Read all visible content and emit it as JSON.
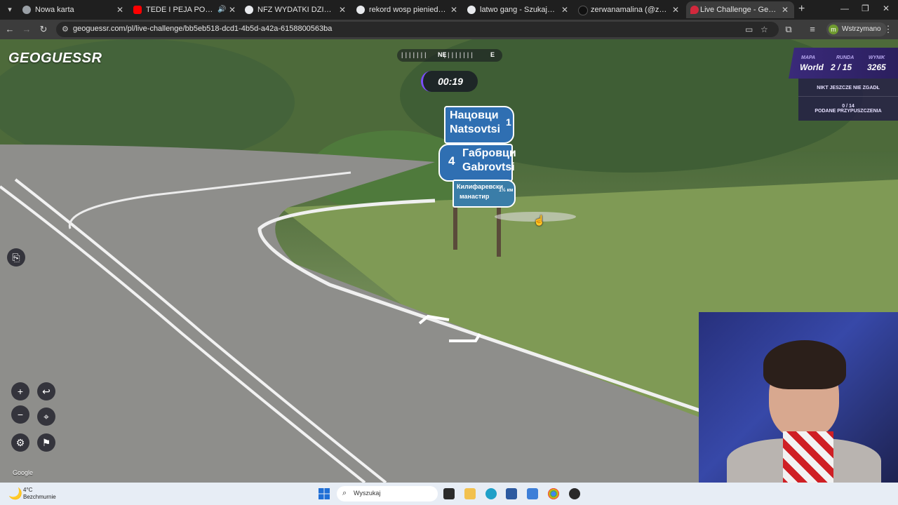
{
  "browser": {
    "tabs": [
      {
        "title": "Nowa karta",
        "active": false
      },
      {
        "title": "TEDE I PEJA POGODZENI? | ...",
        "active": false
      },
      {
        "title": "NFZ WYDATKI DZIENNIE - Szuk",
        "active": false
      },
      {
        "title": "rekord wosp pieniedzy - Szukaj",
        "active": false
      },
      {
        "title": "latwo gang - Szukaj w Google",
        "active": false
      },
      {
        "title": "zerwanamalina (@zerwanamal",
        "active": false
      },
      {
        "title": "Live Challenge - GeoGuessr",
        "active": true
      }
    ],
    "url": "geoguessr.com/pl/live-challenge/bb5eb518-dcd1-4b5d-a42a-6158800563ba",
    "profile_initial": "m",
    "profile_label": "Wstrzymano"
  },
  "game": {
    "logo": "GEOGUESSR",
    "compass": {
      "ne": "NE",
      "e": "E"
    },
    "timer": "00:19",
    "hud": {
      "map_label": "MAPA",
      "map_value": "World",
      "round_label": "RUNDA",
      "round_value": "2 / 15",
      "score_label": "WYNIK",
      "score_value": "3265"
    },
    "panel": {
      "no_guess": "NIKT JESZCZE NIE ZGADŁ",
      "guesses_count": "0 / 14",
      "guesses_label": "PODANE PRZYPUSZCZENIA"
    },
    "google_credit": "Google"
  },
  "signs": {
    "sign1_line1": "Нацовци",
    "sign1_line2": "Natsovtsi",
    "sign1_km": "1",
    "sign2_km": "4",
    "sign2_line1": "Габровци",
    "sign2_line2": "Gabrovtsi",
    "sign3_line1": "Килифаревски",
    "sign3_line2": "манастир",
    "sign3_km": "1½ км"
  },
  "taskbar": {
    "temperature": "4°C",
    "weather": "Bezchmurnie",
    "search_placeholder": "Wyszukaj"
  },
  "colors": {
    "accent": "#7c4dff",
    "hud_bg": "#3a2a7a",
    "sign_blue": "#2f6fb2"
  }
}
